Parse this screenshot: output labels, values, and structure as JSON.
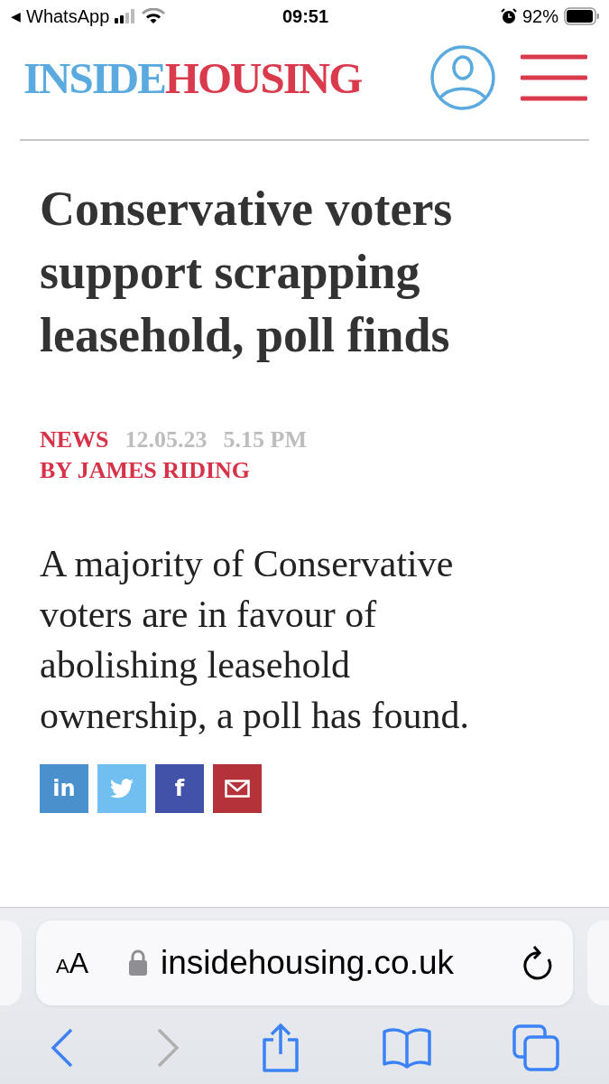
{
  "status_bar": {
    "back_arrow": "◀",
    "back_app": "WhatsApp",
    "time": "09:51",
    "battery": "92%"
  },
  "header": {
    "logo_first": "INSIDE",
    "logo_second": "HOUSING"
  },
  "article": {
    "headline": "Conservative voters support scrapping leasehold, poll finds",
    "category": "NEWS",
    "date": "12.05.23",
    "time": "5.15 PM",
    "byline": "BY JAMES RIDING",
    "lede": "A majority of Conservative voters are in favour of abolishing leasehold ownership, a poll has found."
  },
  "share_buttons": [
    {
      "kind": "linkedin",
      "label": "in",
      "color": "#4a90cc"
    },
    {
      "kind": "twitter",
      "color": "#70bff0"
    },
    {
      "kind": "facebook",
      "label": "f",
      "color": "#4252a8"
    },
    {
      "kind": "email",
      "color": "#b4333a"
    }
  ],
  "browser": {
    "text_size": "AA",
    "url": "insidehousing.co.uk"
  }
}
